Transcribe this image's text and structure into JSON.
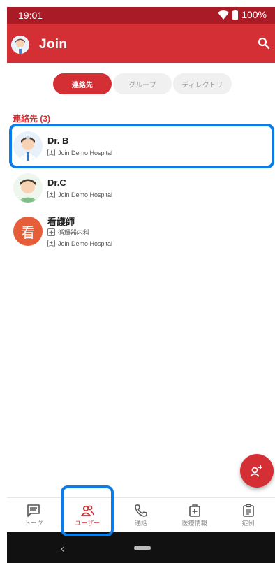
{
  "status_bar": {
    "time": "19:01",
    "battery": "100%"
  },
  "app_bar": {
    "title": "Join"
  },
  "tabs": [
    {
      "label": "連絡先",
      "active": true
    },
    {
      "label": "グループ",
      "active": false
    },
    {
      "label": "ディレクトリ",
      "active": false
    }
  ],
  "section": {
    "header": "連絡先 (3)"
  },
  "contacts": [
    {
      "name": "Dr. B",
      "hospital": "Join Demo Hospital"
    },
    {
      "name": "Dr.C",
      "hospital": "Join Demo Hospital"
    },
    {
      "name": "看護師",
      "avatar_char": "看",
      "department": "循環器内科",
      "hospital": "Join Demo Hospital"
    }
  ],
  "bottom_nav": [
    {
      "label": "トーク",
      "icon": "chat-icon",
      "active": false
    },
    {
      "label": "ユーザー",
      "icon": "users-icon",
      "active": true
    },
    {
      "label": "通話",
      "icon": "phone-icon",
      "active": false
    },
    {
      "label": "医療情報",
      "icon": "medical-icon",
      "active": false
    },
    {
      "label": "症例",
      "icon": "clipboard-icon",
      "active": false
    }
  ],
  "colors": {
    "primary": "#d32f34",
    "status_bar": "#a91b27",
    "highlight": "#0b7ce8"
  }
}
